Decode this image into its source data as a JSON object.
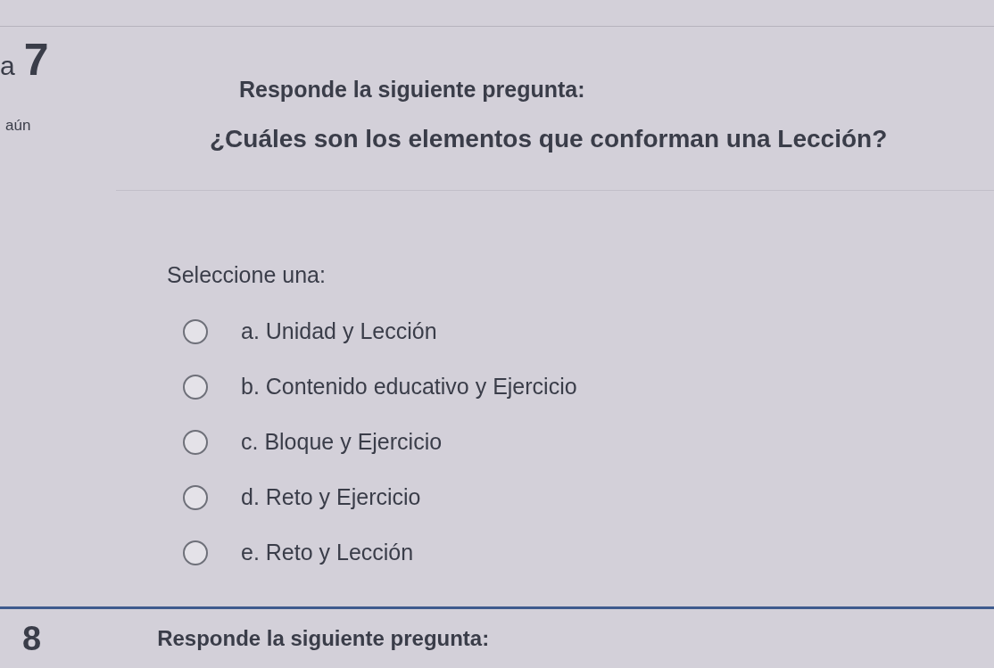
{
  "question": {
    "number_label": "a",
    "number": "7",
    "status": "aún",
    "instruction": "Responde la siguiente pregunta:",
    "text": "¿Cuáles son los elementos que conforman una Lección?",
    "prompt": "Seleccione una:",
    "options": [
      {
        "label": "a. Unidad y Lección",
        "selected": false
      },
      {
        "label": "b. Contenido educativo y Ejercicio",
        "selected": false
      },
      {
        "label": "c. Bloque y Ejercicio",
        "selected": false
      },
      {
        "label": "d. Reto y Ejercicio",
        "selected": false
      },
      {
        "label": "e. Reto y Lección",
        "selected": false
      }
    ]
  },
  "next_question": {
    "number": "8",
    "instruction": "Responde la siguiente pregunta:"
  }
}
